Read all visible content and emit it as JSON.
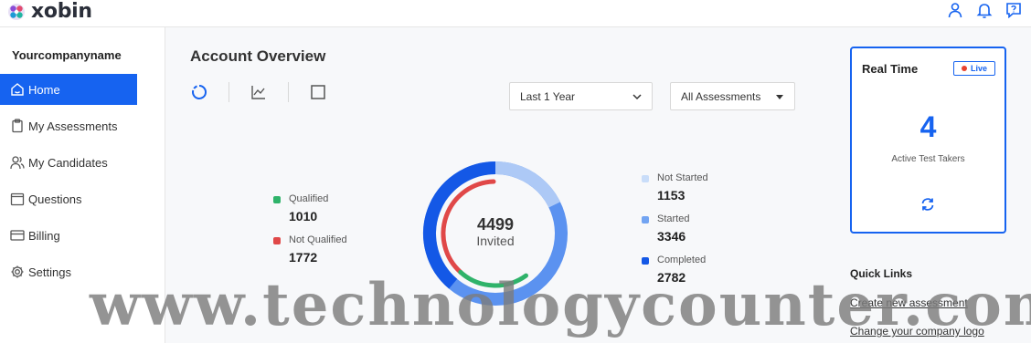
{
  "brand": {
    "name": "xobin",
    "logo_icon": "xobin-logo-icon"
  },
  "header": {
    "icons": [
      "user-icon",
      "bell-icon",
      "help-icon"
    ]
  },
  "sidebar": {
    "company": "Yourcompanyname",
    "items": [
      {
        "label": "Home",
        "icon": "home-icon",
        "active": true
      },
      {
        "label": "My Assessments",
        "icon": "clipboard-icon"
      },
      {
        "label": "My Candidates",
        "icon": "users-icon"
      },
      {
        "label": "Questions",
        "icon": "questions-icon"
      },
      {
        "label": "Billing",
        "icon": "card-icon"
      },
      {
        "label": "Settings",
        "icon": "gear-icon"
      }
    ]
  },
  "overview": {
    "title": "Account Overview",
    "view_icons": [
      "donut-chart-icon",
      "line-chart-icon",
      "table-icon"
    ],
    "period_filter": "Last 1 Year",
    "assessment_filter": "All Assessments",
    "summary": {
      "total": "4499",
      "label": "Invited"
    },
    "legend_left": [
      {
        "label": "Qualified",
        "value": "1010",
        "color": "#2fb36a"
      },
      {
        "label": "Not Qualified",
        "value": "1772",
        "color": "#e04848"
      }
    ],
    "legend_right": [
      {
        "label": "Not Started",
        "value": "1153",
        "color": "#c9ddf9"
      },
      {
        "label": "Started",
        "value": "3346",
        "color": "#72a4f2"
      },
      {
        "label": "Completed",
        "value": "2782",
        "color": "#1458e6"
      }
    ]
  },
  "realtime": {
    "title": "Real Time",
    "badge": "Live",
    "count": "4",
    "label": "Active Test Takers",
    "refresh_icon": "refresh-icon"
  },
  "quick_links": {
    "title": "Quick Links",
    "links": [
      "Create new assessment",
      "Change your company logo"
    ]
  },
  "watermark": "www.technologycounter.com",
  "colors": {
    "accent": "#1663f0",
    "qualified": "#2fb36a",
    "not_qualified": "#e04848",
    "not_started": "#adc9f6",
    "started": "#5b92f0",
    "completed": "#1458e6"
  }
}
